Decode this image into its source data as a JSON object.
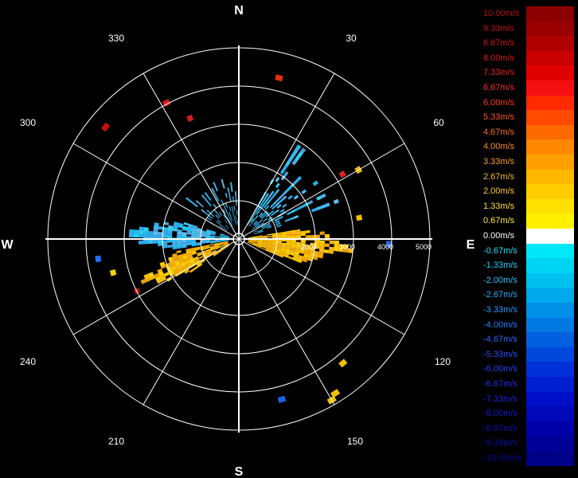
{
  "compass": {
    "north": "N",
    "south": "S",
    "east": "E",
    "west": "W",
    "bearings": [
      "30",
      "60",
      "120",
      "150",
      "210",
      "240",
      "300",
      "330"
    ]
  },
  "range_labels": [
    "2000",
    "3000",
    "4000",
    "5000"
  ],
  "legend": {
    "items": [
      {
        "label": "10.00m/s",
        "color": "#8b0000",
        "text_color": "#b01010"
      },
      {
        "label": "9.33m/s",
        "color": "#9a0000",
        "text_color": "#c01010"
      },
      {
        "label": "8.67m/s",
        "color": "#b00000",
        "text_color": "#d01515"
      },
      {
        "label": "8.00m/s",
        "color": "#c80000",
        "text_color": "#e01818"
      },
      {
        "label": "7.33m/s",
        "color": "#e00000",
        "text_color": "#f02020"
      },
      {
        "label": "6.67m/s",
        "color": "#f41010",
        "text_color": "#ff2a2a"
      },
      {
        "label": "6.00m/s",
        "color": "#ff2a00",
        "text_color": "#ff3a1a"
      },
      {
        "label": "5.33m/s",
        "color": "#ff4a00",
        "text_color": "#ff5520"
      },
      {
        "label": "4.67m/s",
        "color": "#ff6a00",
        "text_color": "#ff7020"
      },
      {
        "label": "4.00m/s",
        "color": "#ff8800",
        "text_color": "#ff8c20"
      },
      {
        "label": "3.33m/s",
        "color": "#ffa000",
        "text_color": "#ffa020"
      },
      {
        "label": "2.67m/s",
        "color": "#ffb800",
        "text_color": "#ffb830"
      },
      {
        "label": "2.00m/s",
        "color": "#ffcc00",
        "text_color": "#ffcc30"
      },
      {
        "label": "1.33m/s",
        "color": "#ffe000",
        "text_color": "#ffe040"
      },
      {
        "label": "0.67m/s",
        "color": "#fff000",
        "text_color": "#fff040"
      },
      {
        "label": "0.00m/s",
        "color": "#ffffff",
        "text_color": "#ffffff"
      },
      {
        "label": "-0.67m/s",
        "color": "#00e8f8",
        "text_color": "#20e0ff"
      },
      {
        "label": "-1.33m/s",
        "color": "#00d4f4",
        "text_color": "#20d0ff"
      },
      {
        "label": "-2.00m/s",
        "color": "#00c0f0",
        "text_color": "#20c0ff"
      },
      {
        "label": "-2.67m/s",
        "color": "#00a8ec",
        "text_color": "#20b0ff"
      },
      {
        "label": "-3.33m/s",
        "color": "#0090e8",
        "text_color": "#2098ff"
      },
      {
        "label": "-4.00m/s",
        "color": "#0078e4",
        "text_color": "#2080ff"
      },
      {
        "label": "-4.67m/s",
        "color": "#0060e0",
        "text_color": "#2068ff"
      },
      {
        "label": "-5.33m/s",
        "color": "#0048dc",
        "text_color": "#2050ff"
      },
      {
        "label": "-6.00m/s",
        "color": "#0030d8",
        "text_color": "#2040f8"
      },
      {
        "label": "-6.67m/s",
        "color": "#0020d0",
        "text_color": "#2030f0"
      },
      {
        "label": "-7.33m/s",
        "color": "#0010c8",
        "text_color": "#2020e0"
      },
      {
        "label": "-8.00m/s",
        "color": "#0008b8",
        "text_color": "#1818d0"
      },
      {
        "label": "-8.67m/s",
        "color": "#0000a8",
        "text_color": "#1010c0"
      },
      {
        "label": "-9.33m/s",
        "color": "#000098",
        "text_color": "#0c0cb0"
      },
      {
        "label": "-10.00m/s",
        "color": "#000088",
        "text_color": "#0808a0"
      }
    ]
  }
}
